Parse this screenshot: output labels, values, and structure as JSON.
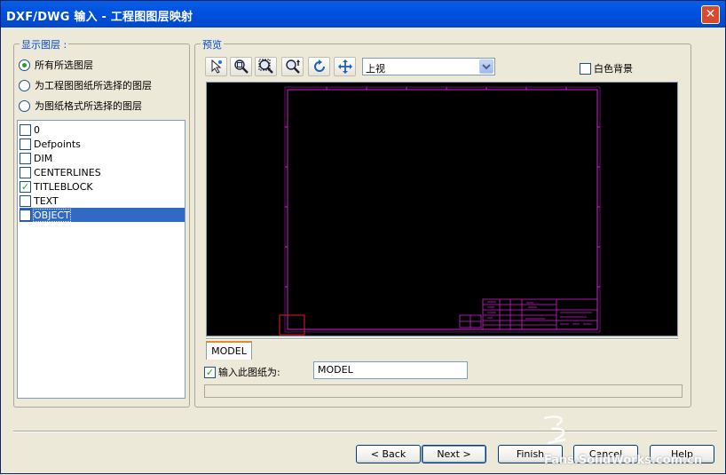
{
  "window": {
    "title": "DXF/DWG 输入 - 工程图图层映射",
    "close_glyph": "✕"
  },
  "layers_group": {
    "title": "显示图层 :",
    "radios": [
      {
        "label": "所有所选图层",
        "selected": true
      },
      {
        "label": "为工程图图纸所选择的图层",
        "selected": false
      },
      {
        "label": "为图纸格式所选择的图层",
        "selected": false
      }
    ],
    "layers": [
      {
        "name": "0",
        "checked": false,
        "highlighted": false
      },
      {
        "name": "Defpoints",
        "checked": false,
        "highlighted": false
      },
      {
        "name": "DIM",
        "checked": false,
        "highlighted": false
      },
      {
        "name": "CENTERLINES",
        "checked": false,
        "highlighted": false
      },
      {
        "name": "TITLEBLOCK",
        "checked": true,
        "highlighted": false
      },
      {
        "name": "TEXT",
        "checked": false,
        "highlighted": false
      },
      {
        "name": "OBJECT",
        "checked": false,
        "highlighted": true
      }
    ],
    "check_glyph": "✓"
  },
  "preview_group": {
    "title": "预览",
    "toolbar_icons": [
      "select-icon",
      "zoom-fit-icon",
      "zoom-area-icon",
      "zoom-in-out-icon",
      "rotate-icon",
      "pan-icon"
    ],
    "view_select": {
      "value": "上视"
    },
    "white_background": {
      "label": "白色背景",
      "checked": false
    },
    "colors": {
      "drawing_stroke": "#d020d0",
      "canvas": "#000000",
      "origin_box": "#e02020"
    },
    "sheet_tab": "MODEL",
    "import_sheet": {
      "label": "输入此图纸为:",
      "checked": true,
      "value": "MODEL"
    }
  },
  "buttons": {
    "back": "< Back",
    "next": "Next >",
    "finish": "Finish",
    "cancel": "Cancel",
    "help": "Help"
  },
  "watermark": {
    "text": "Fans.SolidWorks.com.cn"
  }
}
